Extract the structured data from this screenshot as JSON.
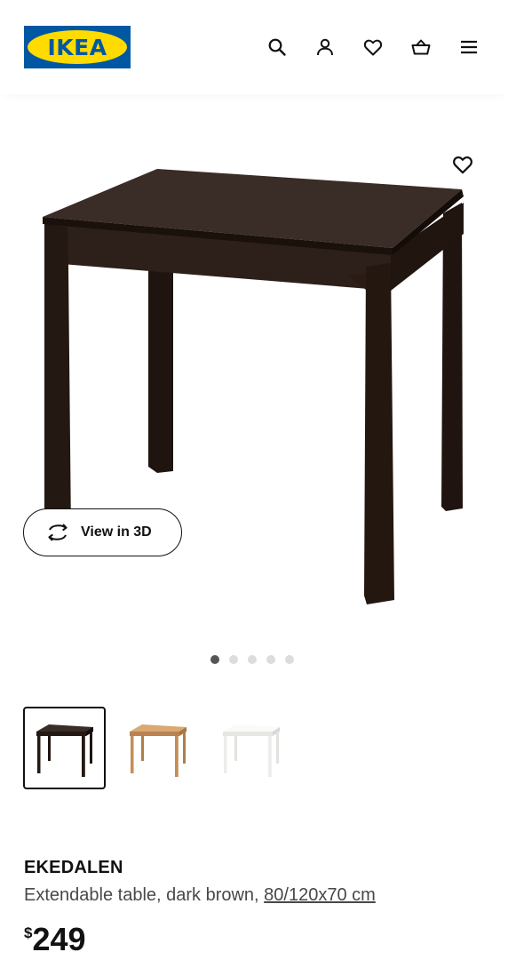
{
  "brand": {
    "logo_text": "IKEA",
    "colors": {
      "blue": "#0058A3",
      "yellow": "#FFDB00"
    }
  },
  "header": {
    "icons": [
      "search-icon",
      "user-icon",
      "heart-icon",
      "basket-icon",
      "menu-icon"
    ]
  },
  "gallery": {
    "view3d_label": "View in 3D",
    "slides_total": 5,
    "slide_active": 1,
    "favourite_icon": "heart-icon"
  },
  "variants": [
    {
      "color_name": "dark brown",
      "swatch": "#2a1c16",
      "selected": true
    },
    {
      "color_name": "oak",
      "swatch": "#c8955e",
      "selected": false
    },
    {
      "color_name": "white",
      "swatch": "#f1f1ee",
      "selected": false
    }
  ],
  "product": {
    "name": "EKEDALEN",
    "description_prefix": "Extendable table, dark brown, ",
    "size_link": "80/120x70 cm",
    "price_currency": "$",
    "price_amount": "249"
  }
}
